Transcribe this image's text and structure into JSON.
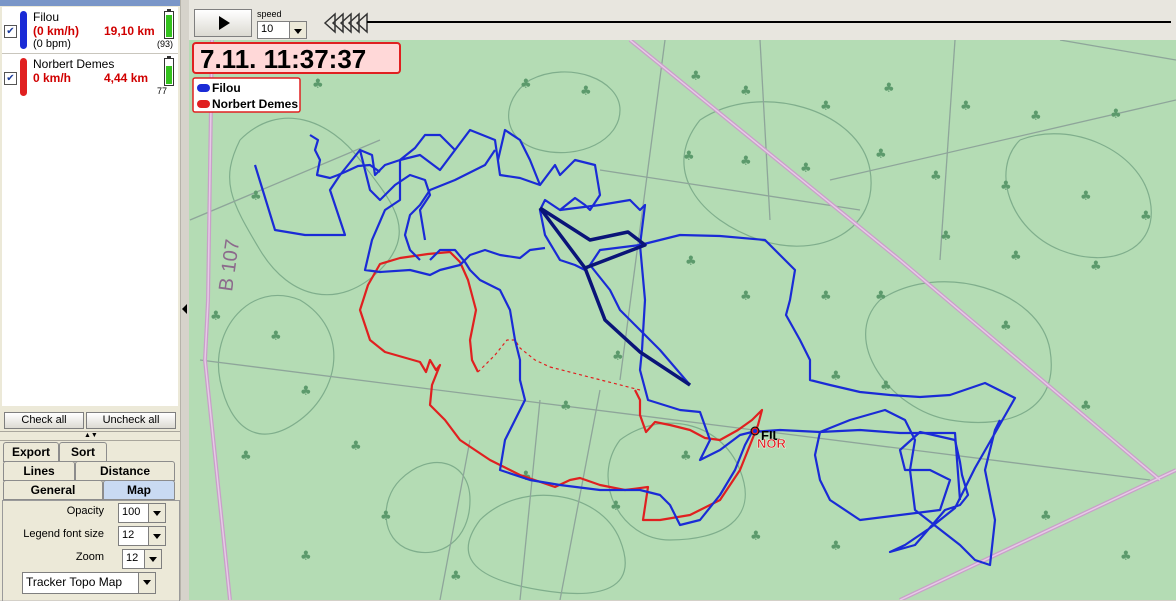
{
  "window_title": "Tracker",
  "tracks": [
    {
      "name": "Filou",
      "speed": "(0 km/h)",
      "distance": "19,10 km",
      "bpm": "(0 bpm)",
      "battery_label": "(93)",
      "battery_level": 0.93,
      "color": "#1a2bd6",
      "checked": "✔"
    },
    {
      "name": "Norbert Demes",
      "speed": "0 km/h",
      "distance": "4,44 km",
      "battery_label": "77",
      "battery_level": 0.77,
      "color": "#e02020",
      "checked": "✔"
    }
  ],
  "buttons": {
    "check_all": "Check all",
    "uncheck_all": "Uncheck all"
  },
  "tabs": {
    "export": "Export",
    "sort": "Sort",
    "lines": "Lines",
    "distance": "Distance",
    "general": "General",
    "map": "Map"
  },
  "settings": {
    "opacity_label": "Opacity",
    "opacity_value": "100",
    "legend_font_label": "Legend font size",
    "legend_font_value": "12",
    "zoom_label": "Zoom",
    "zoom_value": "12",
    "map_type": "Tracker Topo Map"
  },
  "player": {
    "speed_label": "speed",
    "speed_value": "10"
  },
  "map": {
    "timestamp": "7.11. 11:37:37",
    "road_label": "B 107",
    "legend": [
      {
        "name": "Filou",
        "color": "#1a2bd6"
      },
      {
        "name": "Norbert Demes",
        "color": "#e02020"
      }
    ],
    "markers": {
      "filou": "FIL",
      "norbert": "NOR"
    }
  }
}
